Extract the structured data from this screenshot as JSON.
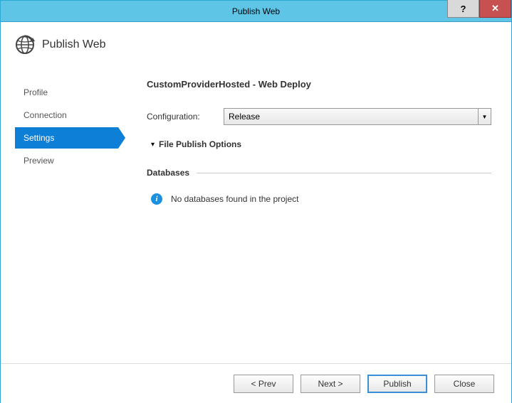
{
  "window": {
    "title": "Publish Web"
  },
  "header": {
    "title": "Publish Web"
  },
  "sidebar": {
    "items": [
      {
        "label": "Profile"
      },
      {
        "label": "Connection"
      },
      {
        "label": "Settings"
      },
      {
        "label": "Preview"
      }
    ]
  },
  "main": {
    "heading": "CustomProviderHosted - Web Deploy",
    "config_label": "Configuration:",
    "config_value": "Release",
    "file_publish_label": "File Publish Options",
    "databases_title": "Databases",
    "databases_info": "No databases found in the project"
  },
  "footer": {
    "prev": "< Prev",
    "next": "Next >",
    "publish": "Publish",
    "close": "Close"
  }
}
